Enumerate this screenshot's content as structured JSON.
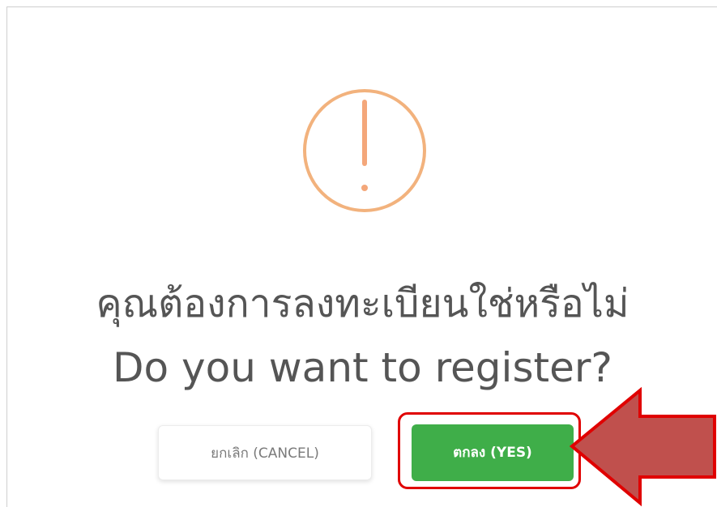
{
  "dialog": {
    "icon": "exclamation-circle-icon",
    "title_th": "คุณต้องการลงทะเบียนใช่หรือไม่",
    "title_en": "Do you want to register?",
    "cancel_label": "ยกเลิก (CANCEL)",
    "confirm_label": "ตกลง (YES)"
  },
  "annotation": {
    "highlight_color": "#e00000",
    "arrow_color": "#c0504d"
  },
  "colors": {
    "icon_stroke": "#f2b27d",
    "icon_mark": "#f4a77a",
    "confirm_bg": "#3fae49",
    "text": "#555555"
  }
}
